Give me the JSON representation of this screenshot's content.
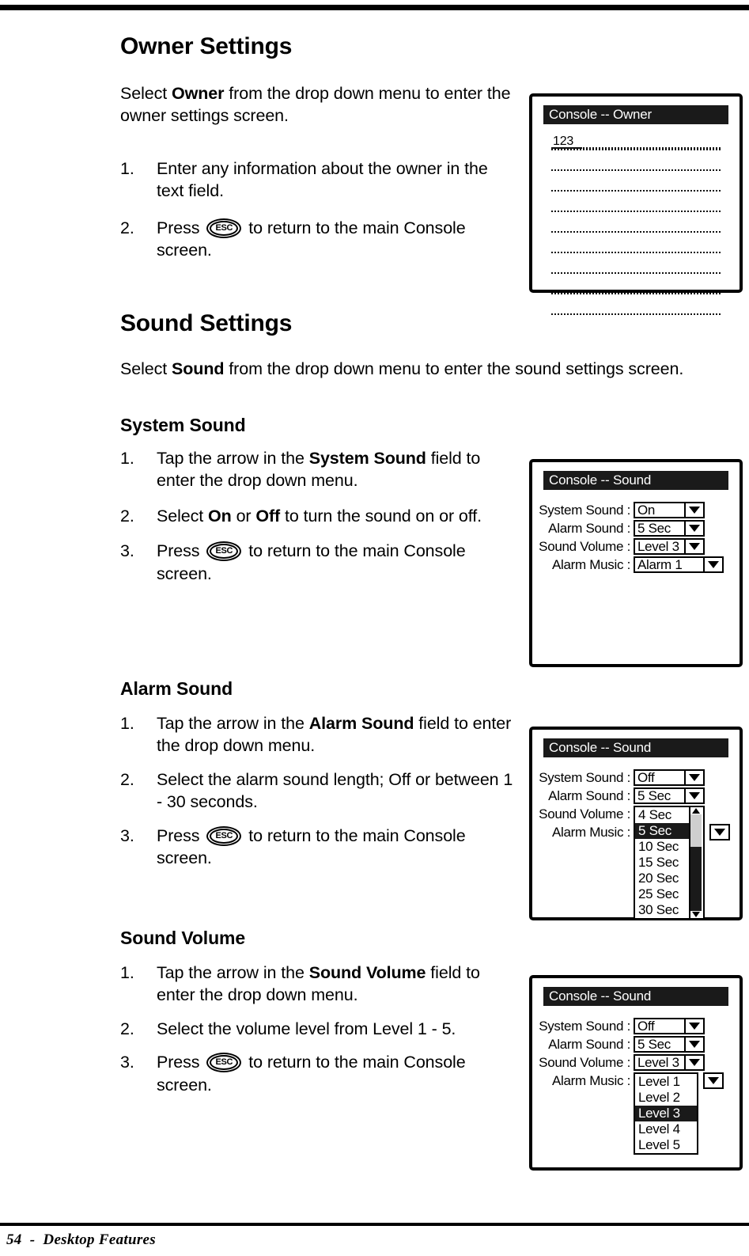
{
  "page": {
    "footer_number": "54",
    "footer_separator": "-",
    "footer_title": "Desktop Features",
    "footer_full": "54  -  Desktop Features"
  },
  "sections": {
    "owner": {
      "heading": "Owner Settings",
      "intro_before": "Select ",
      "intro_bold": "Owner",
      "intro_after": " from the drop down menu to enter the owner settings screen.",
      "steps": [
        {
          "num": "1.",
          "before": "Enter any information about the owner in the text field.",
          "icon": "",
          "after": ""
        },
        {
          "num": "2.",
          "before": "Press ",
          "icon": "ESC",
          "after": " to return to the main Console screen."
        }
      ]
    },
    "sound": {
      "heading": "Sound Settings",
      "intro_before": "Select ",
      "intro_bold": "Sound",
      "intro_after": " from the drop down menu to enter the sound settings screen."
    },
    "system_sound": {
      "heading": "System Sound",
      "steps": [
        {
          "num": "1.",
          "before": "Tap the arrow in the ",
          "bold": "System Sound",
          "after": " field to enter the drop down menu.",
          "icon": ""
        },
        {
          "num": "2.",
          "before": "Select ",
          "bold": "On",
          "mid": " or ",
          "bold2": "Off",
          "after": " to turn the sound on or off.",
          "icon": ""
        },
        {
          "num": "3.",
          "before": "Press ",
          "icon": "ESC",
          "after": " to return to the main Console screen."
        }
      ]
    },
    "alarm_sound": {
      "heading": "Alarm Sound",
      "steps": [
        {
          "num": "1.",
          "before": "Tap the arrow in the ",
          "bold": "Alarm Sound",
          "after": " field to enter the drop down menu.",
          "icon": ""
        },
        {
          "num": "2.",
          "before": "Select the alarm sound length; Off or between 1 - 30 seconds.",
          "icon": "",
          "after": ""
        },
        {
          "num": "3.",
          "before": "Press ",
          "icon": "ESC",
          "after": " to return to the main Console screen."
        }
      ]
    },
    "sound_volume": {
      "heading": "Sound Volume",
      "steps": [
        {
          "num": "1.",
          "before": "Tap the arrow in the ",
          "bold": "Sound Volume",
          "after": " field to enter the drop down menu.",
          "icon": ""
        },
        {
          "num": "2.",
          "before": "Select the volume level from Level 1 - 5.",
          "icon": "",
          "after": ""
        },
        {
          "num": "3.",
          "before": "Press ",
          "icon": "ESC",
          "after": " to return to the main Console screen."
        }
      ]
    }
  },
  "screens": {
    "owner": {
      "title": "Console -- Owner",
      "text_lines": [
        "123",
        "",
        "",
        "",
        "",
        "",
        "",
        "",
        ""
      ]
    },
    "sound_system": {
      "title": "Console -- Sound",
      "fields": [
        {
          "label": "System Sound :",
          "value": "On"
        },
        {
          "label": "Alarm Sound :",
          "value": "5 Sec"
        },
        {
          "label": "Sound Volume :",
          "value": "Level 3"
        },
        {
          "label": "Alarm Music :",
          "value": "Alarm 1"
        }
      ]
    },
    "sound_alarm": {
      "title": "Console -- Sound",
      "fields": [
        {
          "label": "System Sound :",
          "value": "Off"
        },
        {
          "label": "Alarm Sound :",
          "value": "5 Sec"
        },
        {
          "label": "Sound Volume :",
          "value": ""
        },
        {
          "label": "Alarm Music :",
          "value": ""
        }
      ],
      "dropdown": {
        "items": [
          "4 Sec",
          "5 Sec",
          "10 Sec",
          "15 Sec",
          "20 Sec",
          "25 Sec",
          "30 Sec"
        ],
        "selected": "5 Sec",
        "has_scrollbar": true
      }
    },
    "sound_volume": {
      "title": "Console -- Sound",
      "fields": [
        {
          "label": "System Sound :",
          "value": "Off"
        },
        {
          "label": "Alarm Sound :",
          "value": "5 Sec"
        },
        {
          "label": "Sound Volume :",
          "value": "Level 3"
        },
        {
          "label": "Alarm Music :",
          "value": ""
        }
      ],
      "dropdown": {
        "items": [
          "Level 1",
          "Level 2",
          "Level 3",
          "Level 4",
          "Level 5"
        ],
        "selected": "Level 3",
        "has_scrollbar": false
      }
    }
  },
  "colors": {
    "ink": "#000000",
    "paper": "#ffffff",
    "titlebar": "#1a1a1a",
    "highlight": "#1a1a1a",
    "scroll_thumb": "#cfcfcf"
  }
}
